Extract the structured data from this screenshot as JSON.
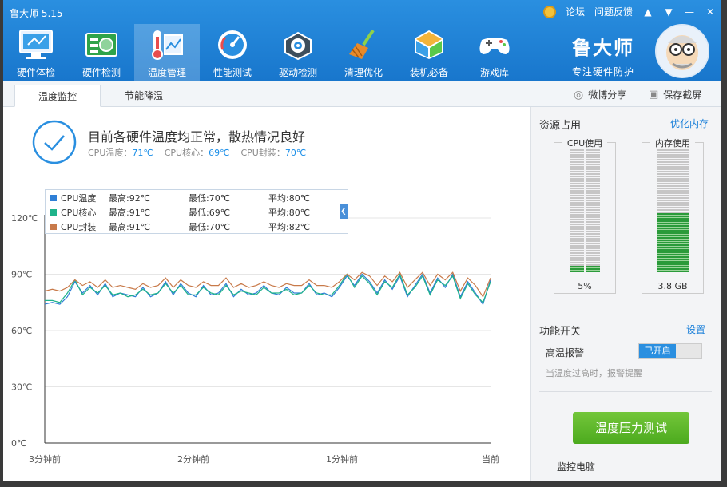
{
  "app": {
    "title": "鲁大师 5.15"
  },
  "titlebar": {
    "forum": "论坛",
    "feedback": "问题反馈"
  },
  "nav": [
    {
      "label": "硬件体检",
      "icon": "monitor-icon"
    },
    {
      "label": "硬件检测",
      "icon": "board-icon"
    },
    {
      "label": "温度管理",
      "icon": "thermometer-icon"
    },
    {
      "label": "性能测试",
      "icon": "gauge-icon"
    },
    {
      "label": "驱动检测",
      "icon": "gear-icon"
    },
    {
      "label": "清理优化",
      "icon": "broom-icon"
    },
    {
      "label": "装机必备",
      "icon": "cube-icon"
    },
    {
      "label": "游戏库",
      "icon": "gamepad-icon"
    }
  ],
  "brand": {
    "name": "鲁大师",
    "slogan": "专注硬件防护"
  },
  "tabs": {
    "monitor": "温度监控",
    "cooling": "节能降温"
  },
  "share": {
    "weibo": "微博分享",
    "screenshot": "保存截屏"
  },
  "status": {
    "title": "目前各硬件温度均正常，散热情况良好",
    "cpu_temp_label": "CPU温度：",
    "cpu_temp": "71℃",
    "cpu_core_label": "CPU核心：",
    "cpu_core": "69℃",
    "cpu_pkg_label": "CPU封装：",
    "cpu_pkg": "70℃"
  },
  "legend": [
    {
      "name": "CPU温度",
      "max": "最高:92℃",
      "min": "最低:70℃",
      "avg": "平均:80℃",
      "color": "#2f7fd6"
    },
    {
      "name": "CPU核心",
      "max": "最高:91℃",
      "min": "最低:69℃",
      "avg": "平均:80℃",
      "color": "#1fb38a"
    },
    {
      "name": "CPU封装",
      "max": "最高:91℃",
      "min": "最低:70℃",
      "avg": "平均:82℃",
      "color": "#c87a4a"
    }
  ],
  "chart_data": {
    "type": "line",
    "y_ticks": [
      "120℃",
      "90℃",
      "60℃",
      "30℃",
      "0℃"
    ],
    "x_ticks": [
      "3分钟前",
      "2分钟前",
      "1分钟前",
      "当前"
    ],
    "ylim": [
      0,
      120
    ],
    "x": [
      0,
      1,
      2,
      3,
      4,
      5,
      6,
      7,
      8,
      9,
      10,
      11,
      12,
      13,
      14,
      15,
      16,
      17,
      18,
      19,
      20,
      21,
      22,
      23,
      24,
      25,
      26,
      27,
      28,
      29,
      30,
      31,
      32,
      33,
      34,
      35,
      36,
      37,
      38,
      39,
      40,
      41,
      42,
      43,
      44,
      45,
      46,
      47,
      48,
      49,
      50,
      51,
      52,
      53,
      54,
      55,
      56,
      57,
      58,
      59
    ],
    "series": [
      {
        "name": "CPU温度",
        "color": "#2f7fd6",
        "values": [
          74,
          75,
          74,
          78,
          86,
          80,
          84,
          79,
          85,
          78,
          80,
          79,
          78,
          83,
          78,
          80,
          86,
          79,
          85,
          80,
          78,
          84,
          79,
          80,
          85,
          78,
          82,
          79,
          80,
          84,
          80,
          79,
          83,
          80,
          80,
          85,
          79,
          80,
          78,
          83,
          89,
          84,
          90,
          86,
          80,
          87,
          82,
          89,
          78,
          84,
          90,
          80,
          88,
          83,
          90,
          78,
          86,
          80,
          74,
          87
        ]
      },
      {
        "name": "CPU核心",
        "color": "#1fb38a",
        "values": [
          76,
          76,
          75,
          80,
          87,
          79,
          83,
          80,
          84,
          79,
          80,
          78,
          79,
          82,
          79,
          80,
          85,
          80,
          84,
          79,
          79,
          83,
          80,
          79,
          84,
          79,
          81,
          80,
          79,
          83,
          80,
          80,
          82,
          79,
          80,
          84,
          80,
          79,
          79,
          84,
          90,
          83,
          89,
          85,
          79,
          86,
          83,
          90,
          79,
          83,
          89,
          79,
          87,
          84,
          89,
          77,
          85,
          79,
          75,
          86
        ]
      },
      {
        "name": "CPU封装",
        "color": "#c87a4a",
        "values": [
          81,
          82,
          81,
          83,
          87,
          84,
          86,
          83,
          87,
          83,
          84,
          83,
          82,
          85,
          83,
          84,
          88,
          83,
          87,
          84,
          83,
          86,
          84,
          84,
          88,
          83,
          85,
          83,
          84,
          86,
          84,
          83,
          85,
          84,
          84,
          87,
          84,
          84,
          83,
          86,
          90,
          87,
          91,
          89,
          84,
          89,
          86,
          91,
          83,
          87,
          91,
          84,
          90,
          87,
          91,
          81,
          88,
          84,
          78,
          88
        ]
      }
    ]
  },
  "resources": {
    "title": "资源占用",
    "optimize": "优化内存",
    "cpu_label": "CPU使用",
    "cpu_value": "5%",
    "cpu_fraction": 0.05,
    "mem_label": "内存使用",
    "mem_value": "3.8 GB",
    "mem_fraction": 0.48
  },
  "features": {
    "title": "功能开关",
    "settings": "设置",
    "alarm_label": "高温报警",
    "alarm_state": "已开启",
    "alarm_desc": "当温度过高时，报警提醒"
  },
  "stress_button": "温度压力测试",
  "footer": {
    "text": "监控电脑"
  }
}
